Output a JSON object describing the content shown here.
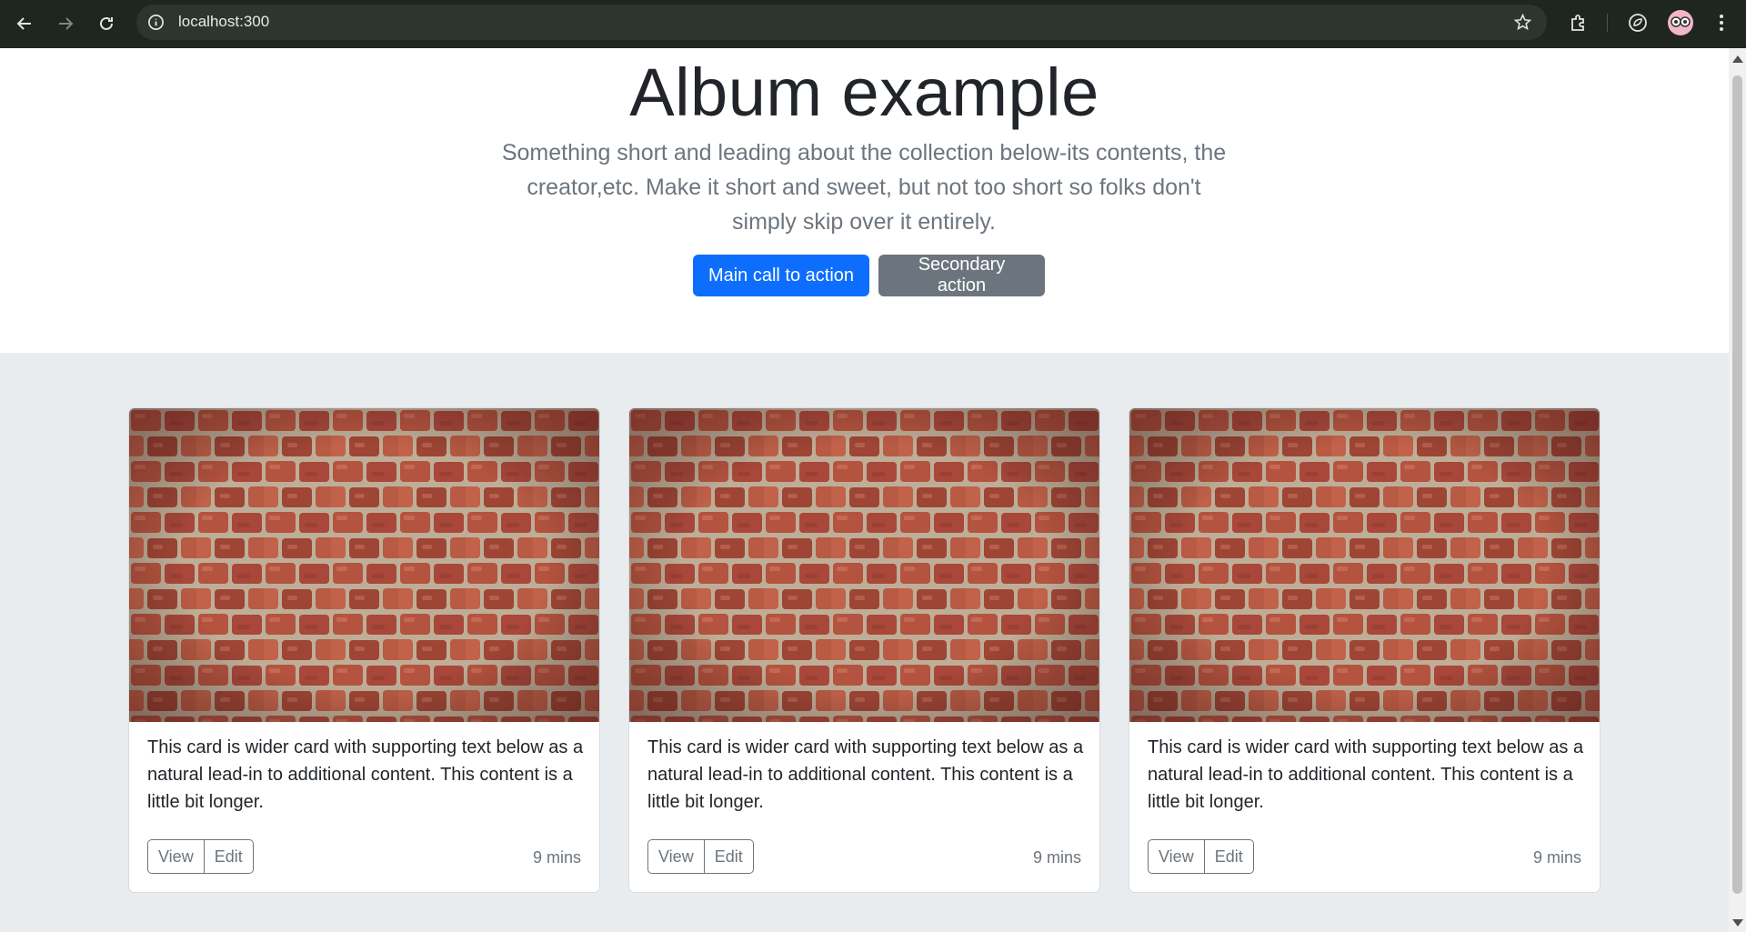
{
  "browser": {
    "url": "localhost:300",
    "back_icon": "arrow-left-icon",
    "forward_icon": "arrow-right-icon",
    "reload_icon": "reload-icon",
    "site_info_icon": "info-icon",
    "bookmark_icon": "star-icon",
    "extensions_icon": "puzzle-icon",
    "performance_icon": "leaf-icon",
    "profile_icon": "avatar-icon",
    "menu_icon": "kebab-menu-icon"
  },
  "hero": {
    "title": "Album example",
    "lead": "Something short and leading about the collection below-its contents, the creator,etc. Make it short and sweet, but not too short so folks don't simply skip over it entirely.",
    "primary_label": "Main call to action",
    "secondary_label": "Secondary action"
  },
  "cards": [
    {
      "text": "This card is wider card with supporting text below as a natural lead-in to additional content. This content is a little bit longer.",
      "view_label": "View",
      "edit_label": "Edit",
      "time": "9 mins"
    },
    {
      "text": "This card is wider card with supporting text below as a natural lead-in to additional content. This content is a little bit longer.",
      "view_label": "View",
      "edit_label": "Edit",
      "time": "9 mins"
    },
    {
      "text": "This card is wider card with supporting text below as a natural lead-in to additional content. This content is a little bit longer.",
      "view_label": "View",
      "edit_label": "Edit",
      "time": "9 mins"
    }
  ],
  "colors": {
    "primary": "#0d6efd",
    "secondary": "#6c757d",
    "album_background": "#e9ecef",
    "brick_red": "#b5523c",
    "mortar": "#c9b8a3"
  }
}
